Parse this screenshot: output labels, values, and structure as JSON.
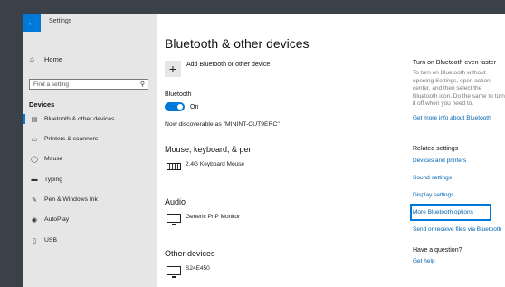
{
  "window": {
    "title": "Settings",
    "back_icon": "back-arrow-icon"
  },
  "sidebar": {
    "home_label": "Home",
    "search_placeholder": "Find a setting",
    "section_label": "Devices",
    "items": [
      {
        "label": "Bluetooth & other devices",
        "icon": "bluetooth-devices-icon",
        "selected": true
      },
      {
        "label": "Printers & scanners",
        "icon": "printer-icon"
      },
      {
        "label": "Mouse",
        "icon": "mouse-icon"
      },
      {
        "label": "Typing",
        "icon": "keyboard-icon"
      },
      {
        "label": "Pen & Windows Ink",
        "icon": "pen-icon"
      },
      {
        "label": "AutoPlay",
        "icon": "autoplay-icon"
      },
      {
        "label": "USB",
        "icon": "usb-icon"
      }
    ]
  },
  "main": {
    "title": "Bluetooth & other devices",
    "add_device_label": "Add Bluetooth or other device",
    "bluetooth_label": "Bluetooth",
    "toggle_state": "On",
    "discoverable_text": "Now discoverable as \"MININT-CUT9ERC\"",
    "groups": {
      "input_title": "Mouse, keyboard, & pen",
      "input_device": "2.4G Keyboard Mouse",
      "audio_title": "Audio",
      "audio_device": "Generic PnP Monitor",
      "other_title": "Other devices",
      "other_device": "S24E450"
    }
  },
  "right_panel": {
    "tip_title": "Turn on Bluetooth even faster",
    "tip_text": "To turn on Bluetooth without opening Settings, open action center, and then select the Bluetooth icon. Do the same to turn it off when you need to.",
    "tip_link": "Get more info about Bluetooth",
    "related_title": "Related settings",
    "links": [
      "Devices and printers",
      "Sound settings",
      "Display settings",
      "More Bluetooth options",
      "Send or receive files via Bluetooth"
    ],
    "question_title": "Have a question?",
    "help_link": "Get help"
  },
  "colors": {
    "accent": "#0078d7",
    "link": "#0063b1",
    "sidebar_bg": "#e6e6e6"
  }
}
